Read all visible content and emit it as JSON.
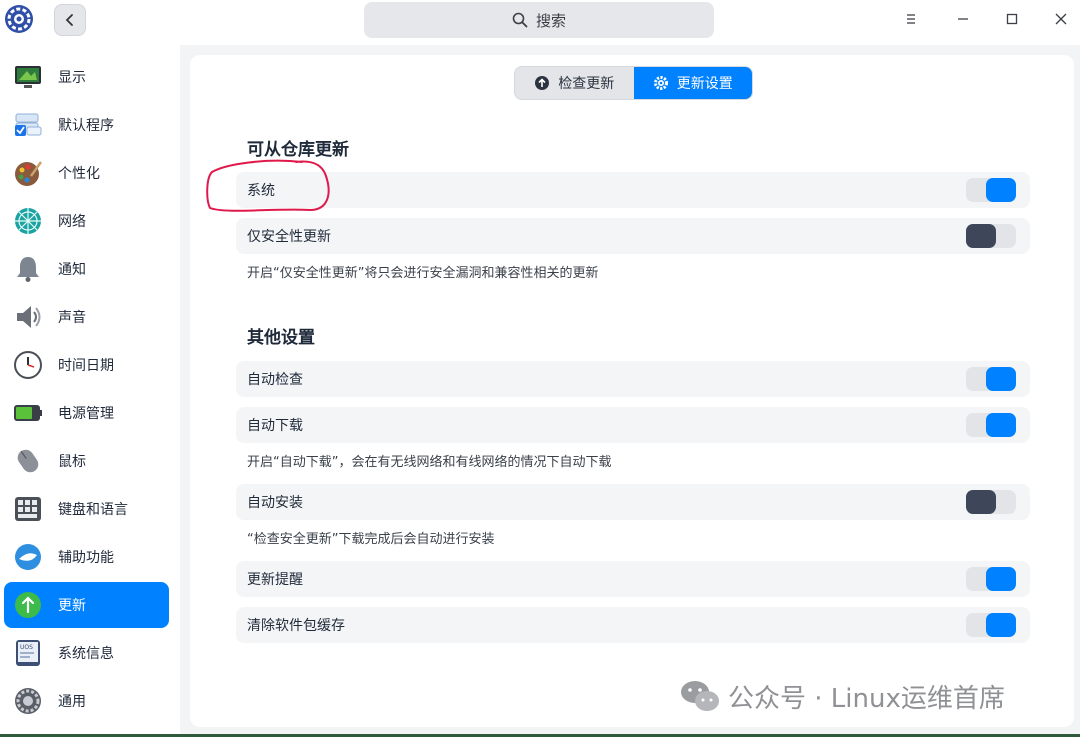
{
  "search": {
    "label": "搜索"
  },
  "sidebar": {
    "items": [
      {
        "label": "显示",
        "icon": "monitor-icon"
      },
      {
        "label": "默认程序",
        "icon": "default-apps-icon"
      },
      {
        "label": "个性化",
        "icon": "palette-icon"
      },
      {
        "label": "网络",
        "icon": "network-icon"
      },
      {
        "label": "通知",
        "icon": "bell-icon"
      },
      {
        "label": "声音",
        "icon": "speaker-icon"
      },
      {
        "label": "时间日期",
        "icon": "clock-icon"
      },
      {
        "label": "电源管理",
        "icon": "battery-icon"
      },
      {
        "label": "鼠标",
        "icon": "mouse-icon"
      },
      {
        "label": "键盘和语言",
        "icon": "keyboard-icon"
      },
      {
        "label": "辅助功能",
        "icon": "accessibility-icon"
      },
      {
        "label": "更新",
        "icon": "update-arrow-icon",
        "active": true
      },
      {
        "label": "系统信息",
        "icon": "system-info-icon"
      },
      {
        "label": "通用",
        "icon": "gear-icon"
      }
    ]
  },
  "tabs": {
    "check": "检查更新",
    "settings": "更新设置"
  },
  "repo_section": {
    "title": "可从仓库更新",
    "system": {
      "label": "系统",
      "on": true
    },
    "security_only": {
      "label": "仅安全性更新",
      "on": false
    },
    "security_hint": "开启“仅安全性更新”将只会进行安全漏洞和兼容性相关的更新"
  },
  "other_section": {
    "title": "其他设置",
    "auto_check": {
      "label": "自动检查",
      "on": true
    },
    "auto_download": {
      "label": "自动下载",
      "on": true
    },
    "auto_download_hint": "开启“自动下载”，会在有无线网络和有线网络的情况下自动下载",
    "auto_install": {
      "label": "自动安装",
      "on": false
    },
    "auto_install_hint": "“检查安全更新”下载完成后会自动进行安装",
    "update_reminder": {
      "label": "更新提醒",
      "on": true
    },
    "clear_cache": {
      "label": "清除软件包缓存",
      "on": true
    }
  },
  "watermark": "公众号 · Linux运维首席",
  "colors": {
    "accent": "#0081ff",
    "switch_off": "#3e4759",
    "annotation": "#e0194b"
  }
}
